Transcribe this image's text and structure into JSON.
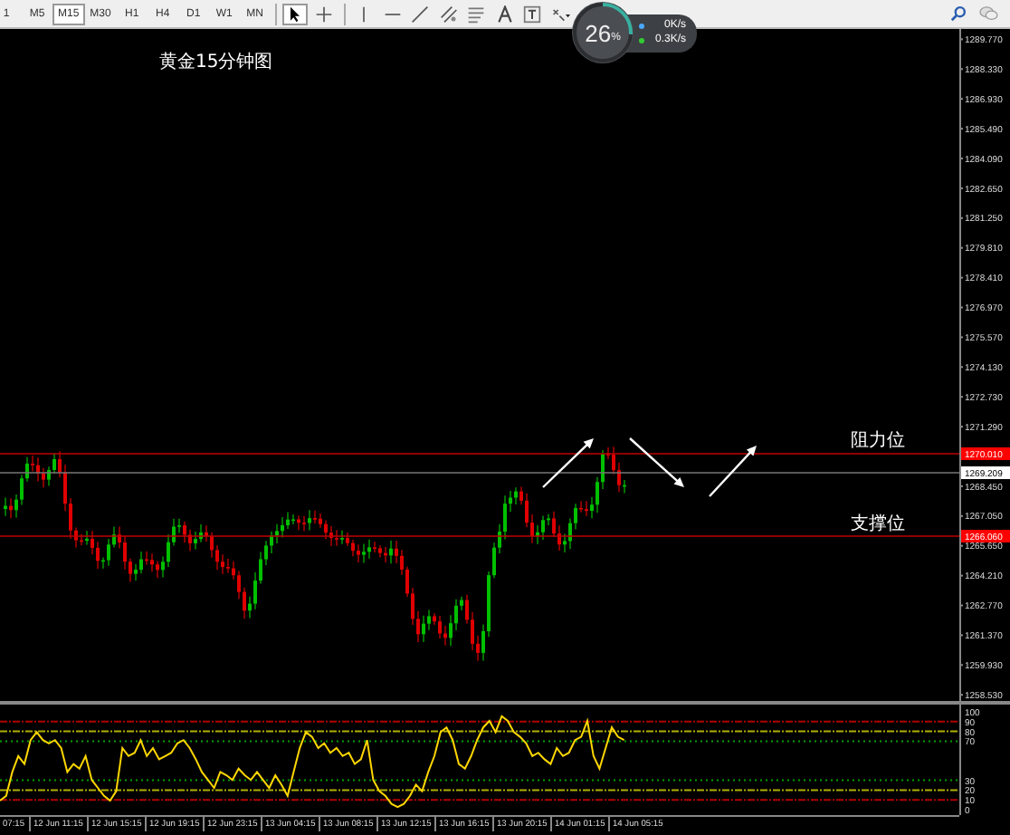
{
  "toolbar": {
    "timeframes": [
      {
        "label": "1",
        "selected": false
      },
      {
        "label": "M5",
        "selected": false
      },
      {
        "label": "M15",
        "selected": true
      },
      {
        "label": "M30",
        "selected": false
      },
      {
        "label": "H1",
        "selected": false
      },
      {
        "label": "H4",
        "selected": false
      },
      {
        "label": "D1",
        "selected": false
      },
      {
        "label": "W1",
        "selected": false
      },
      {
        "label": "MN",
        "selected": false
      }
    ],
    "tools": [
      {
        "kind": "cursor",
        "selected": true
      },
      {
        "kind": "crosshair",
        "selected": false
      },
      {
        "kind": "vline",
        "selected": false
      },
      {
        "kind": "hline",
        "selected": false
      },
      {
        "kind": "trendline",
        "selected": false
      },
      {
        "kind": "channel",
        "selected": false
      },
      {
        "kind": "fibo",
        "selected": false
      },
      {
        "kind": "text",
        "selected": false
      },
      {
        "kind": "label",
        "selected": false
      },
      {
        "kind": "shapes",
        "selected": false
      }
    ]
  },
  "network_gauge": {
    "percent": "26",
    "unit": "%",
    "level": 0.26,
    "upload": "0K/s",
    "download": "0.3K/s"
  },
  "chart": {
    "title": "黄金15分钟图",
    "price_axis": [
      "1289.770",
      "1288.330",
      "1286.930",
      "1285.490",
      "1284.090",
      "1282.650",
      "1281.250",
      "1279.810",
      "1278.410",
      "1276.970",
      "1275.570",
      "1274.130",
      "1272.730",
      "1271.290",
      "1268.450",
      "1267.050",
      "1265.650",
      "1264.210",
      "1262.770",
      "1261.370",
      "1259.930",
      "1258.530"
    ],
    "price_tags": [
      {
        "text": "1270.010",
        "color": "#ff0000"
      },
      {
        "text": "1269.209",
        "color": "#ffffff"
      },
      {
        "text": "1266.060",
        "color": "#ff0000"
      }
    ],
    "annotations": [
      {
        "kind": "resistance",
        "text": "阻力位"
      },
      {
        "kind": "support",
        "text": "支撑位"
      }
    ]
  },
  "oscillator": {
    "levels": [
      "100",
      "90",
      "80",
      "70",
      "30",
      "20",
      "10",
      "0"
    ]
  },
  "time_axis": [
    "07:15",
    "12 Jun 11:15",
    "12 Jun 15:15",
    "12 Jun 19:15",
    "12 Jun 23:15",
    "13 Jun 04:15",
    "13 Jun 08:15",
    "13 Jun 12:15",
    "13 Jun 16:15",
    "13 Jun 20:15",
    "14 Jun 01:15",
    "14 Jun 05:15"
  ]
}
